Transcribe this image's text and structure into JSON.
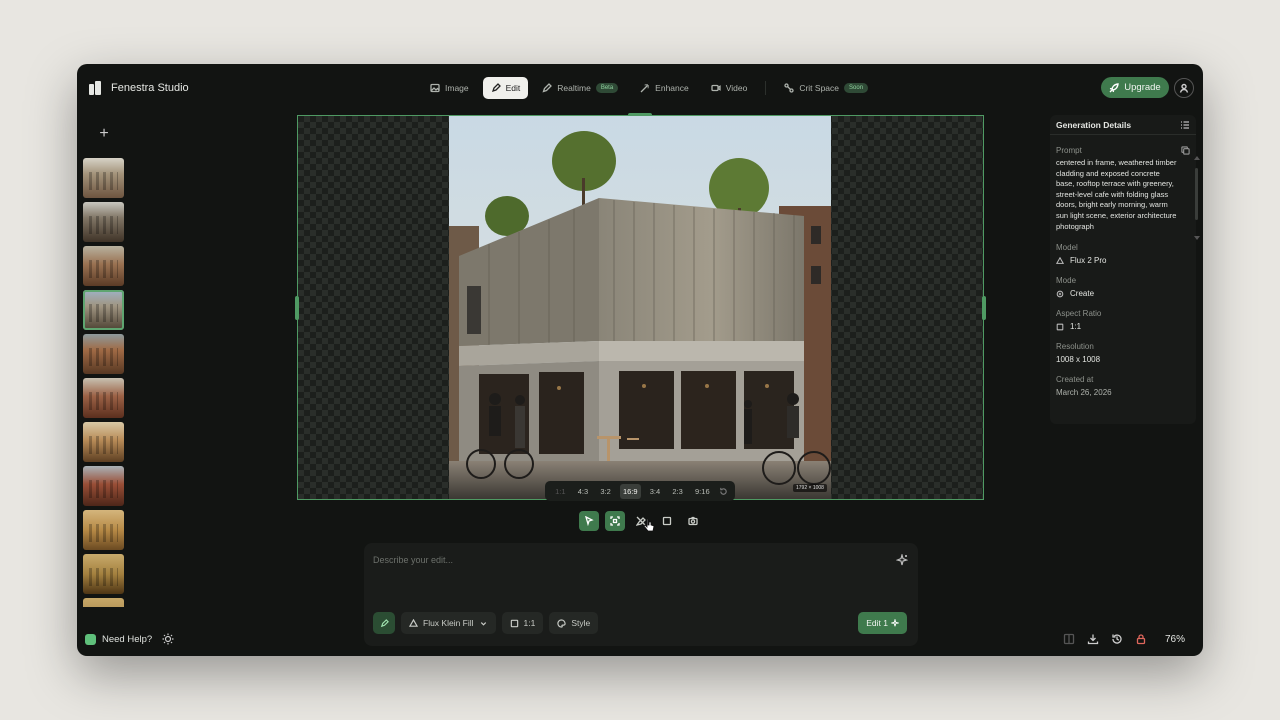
{
  "app": {
    "name": "Fenestra Studio"
  },
  "nav": {
    "items": [
      {
        "label": "Image",
        "icon": "image-icon"
      },
      {
        "label": "Edit",
        "icon": "pencil-icon",
        "active": true
      },
      {
        "label": "Realtime",
        "icon": "pen-icon",
        "badge": "Beta"
      },
      {
        "label": "Enhance",
        "icon": "wand-icon"
      },
      {
        "label": "Video",
        "icon": "video-icon"
      },
      {
        "label": "Crit Space",
        "icon": "nodes-icon",
        "badge": "Soon"
      }
    ],
    "upgrade_label": "Upgrade"
  },
  "canvas": {
    "dimensions": "1792 × 1008",
    "ratios": [
      "1:1",
      "4:3",
      "3:2",
      "16:9",
      "3:4",
      "2:3",
      "9:16"
    ],
    "selected_ratio": "16:9"
  },
  "edit": {
    "placeholder": "Describe your edit...",
    "model_label": "Flux Klein Fill",
    "ratio_label": "1:1",
    "style_label": "Style",
    "submit_label": "Edit 1"
  },
  "details": {
    "title": "Generation Details",
    "prompt_label": "Prompt",
    "prompt": "centered in frame, weathered timber cladding and exposed concrete base, rooftop terrace with greenery, street-level cafe with folding glass doors, bright early morning, warm sun light scene, exterior architecture photograph",
    "model_label": "Model",
    "model": "Flux 2 Pro",
    "mode_label": "Mode",
    "mode": "Create",
    "aspect_label": "Aspect Ratio",
    "aspect": "1:1",
    "resolution_label": "Resolution",
    "resolution": "1008 x 1008",
    "created_label": "Created at",
    "created": "March 26, 2026"
  },
  "footer": {
    "help_label": "Need Help?",
    "zoom": "76%"
  },
  "colors": {
    "accent": "#3f7a4d",
    "frame": "#4f9a63",
    "background": "#121412",
    "lock": "#e0675c"
  }
}
